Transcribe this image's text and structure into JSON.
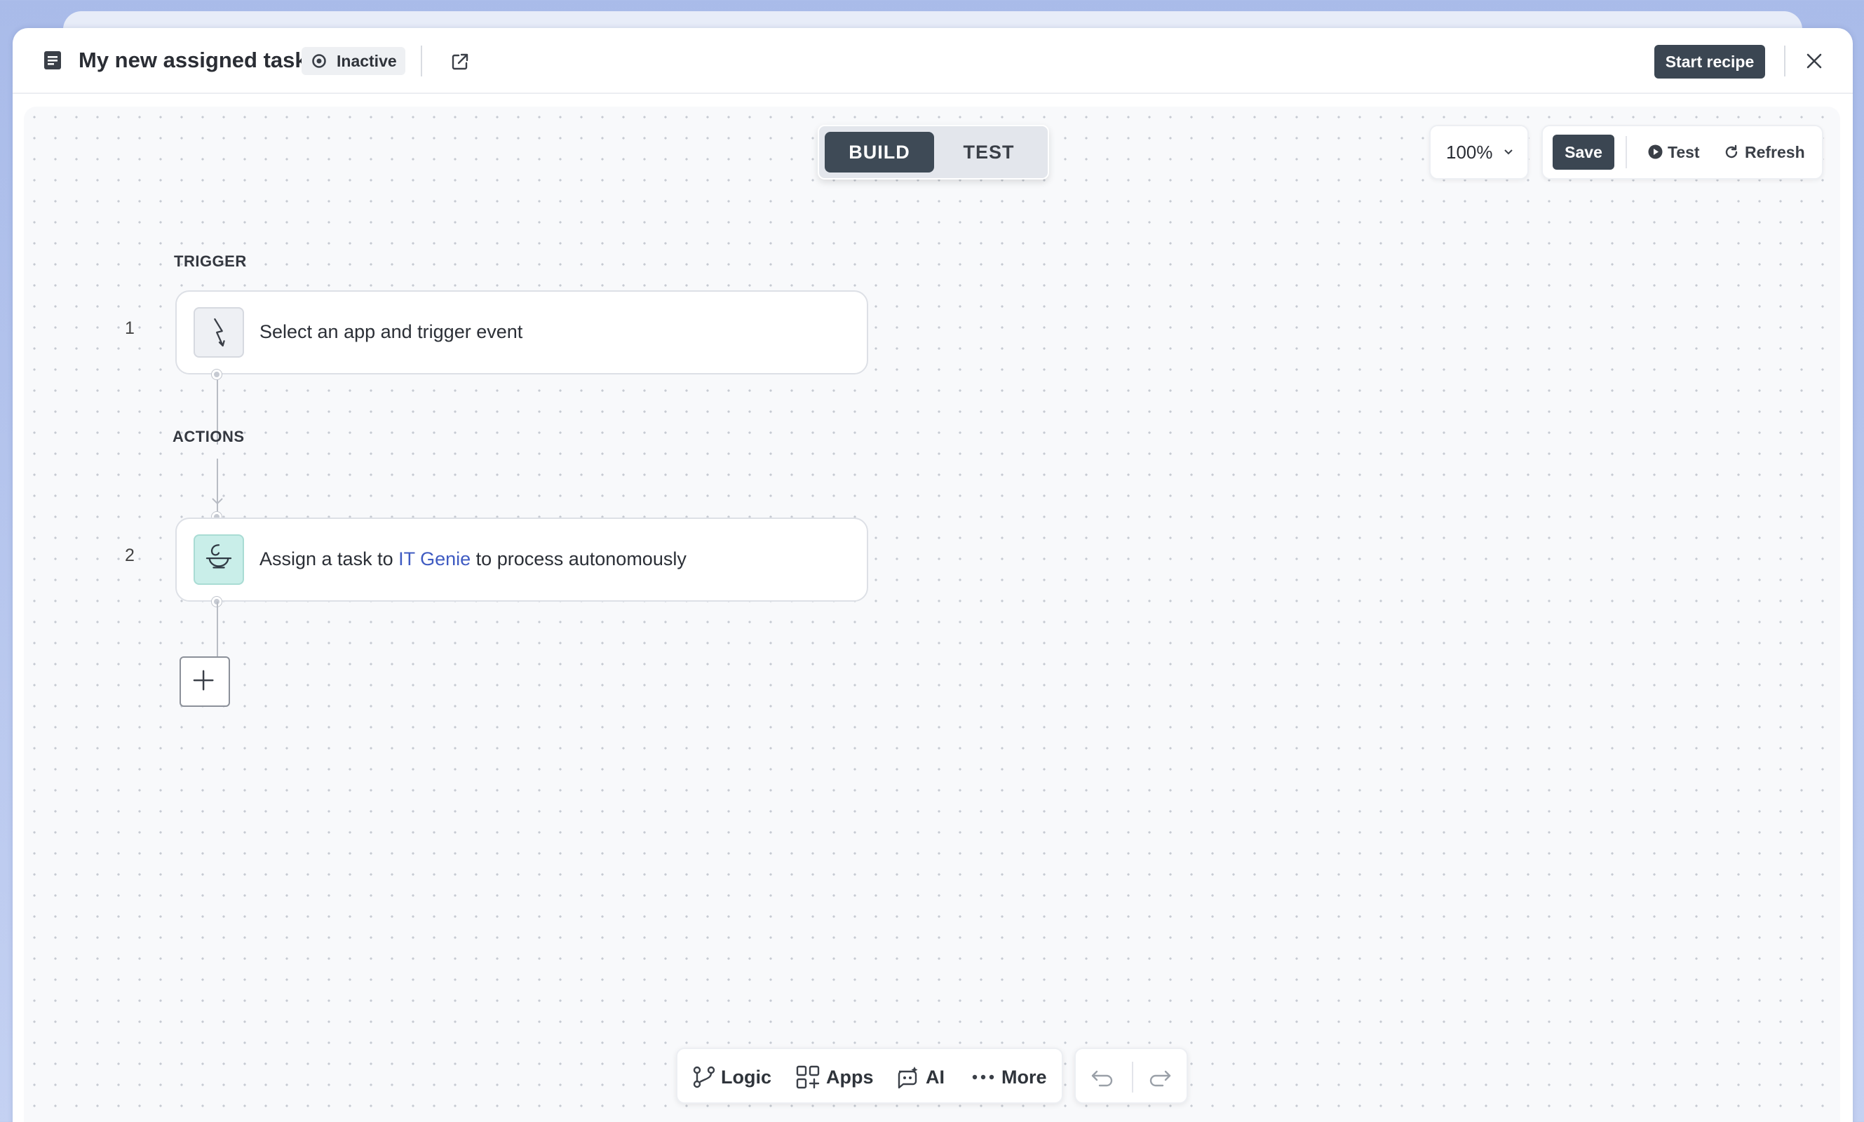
{
  "header": {
    "title": "My new assigned task",
    "status": "Inactive",
    "start_button": "Start recipe"
  },
  "mode": {
    "build": "BUILD",
    "test": "TEST",
    "active": "BUILD"
  },
  "toolbar": {
    "zoom": "100%",
    "save": "Save",
    "test": "Test",
    "refresh": "Refresh"
  },
  "flow": {
    "trigger_label": "TRIGGER",
    "actions_label": "ACTIONS",
    "steps": [
      {
        "number": "1",
        "text": "Select an app and trigger event",
        "icon": "lightning-icon"
      },
      {
        "number": "2",
        "text_before": "Assign a task to ",
        "link": "IT Genie",
        "text_after": " to process autonomously",
        "icon": "genie-lamp-icon"
      }
    ]
  },
  "bottom_bar": {
    "logic": "Logic",
    "apps": "Apps",
    "ai": "AI",
    "more": "More"
  },
  "colors": {
    "accent_dark": "#3b4652",
    "link": "#3f5bc2",
    "genie_icon_bg": "#c9eee9"
  }
}
